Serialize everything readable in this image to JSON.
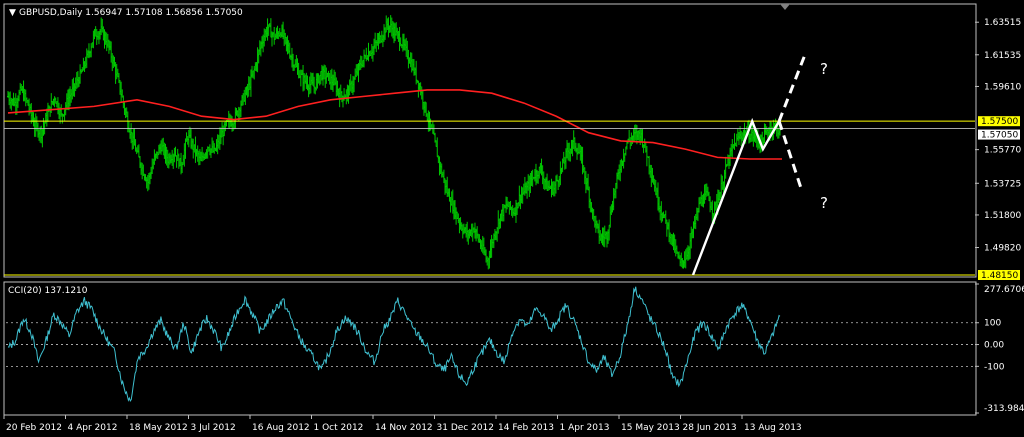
{
  "header": {
    "menu_arrow": "▼",
    "title": "GBPUSD,Daily  1.56947 1.57108 1.56856 1.57050"
  },
  "cci": {
    "label": "CCI(20) 137.1210"
  },
  "annotations": {
    "question_up": "?",
    "question_down": "?"
  },
  "colors": {
    "background": "#000000",
    "bars": "#00c800",
    "ma": "#ff2020",
    "support_resistance": "#ffff00",
    "cci_line": "#3fbfcf",
    "grid": "#c0c0c0",
    "price_tag_bg": "#ffff00",
    "current_tag_bg": "#ffffff",
    "axis_text": "#ffffff",
    "overlay": "#ffffff"
  },
  "chart_data": [
    {
      "type": "ohlc",
      "symbol": "GBPUSD",
      "timeframe": "Daily",
      "ohlc_current": {
        "open": 1.56947,
        "high": 1.57108,
        "low": 1.56856,
        "close": 1.5705
      },
      "ylim": [
        1.4815,
        1.645
      ],
      "y_ticks": [
        1.63515,
        1.61535,
        1.5961,
        1.5577,
        1.53725,
        1.518,
        1.4982
      ],
      "y_tick_labels": [
        "1.63515",
        "1.61535",
        "1.59610",
        "1.55770",
        "1.53725",
        "1.51800",
        "1.49820"
      ],
      "x_tick_labels": [
        "20 Feb 2012",
        "4 Apr 2012",
        "18 May 2012",
        "3 Jul 2012",
        "16 Aug 2012",
        "1 Oct 2012",
        "14 Nov 2012",
        "31 Dec 2012",
        "14 Feb 2013",
        "1 Apr 2013",
        "15 May 2013",
        "28 Jun 2013",
        "13 Aug 2013"
      ],
      "horizontal_levels": [
        {
          "value": 1.575,
          "label": "1.57500"
        },
        {
          "value": 1.4815,
          "label": "1.48150"
        }
      ],
      "current_price": {
        "value": 1.5705,
        "label": "1.57050"
      },
      "series": [
        {
          "kind": "close_path",
          "values": [
            [
              0,
              1.59
            ],
            [
              6,
              1.586
            ],
            [
              12,
              1.594
            ],
            [
              18,
              1.585
            ],
            [
              24,
              1.572
            ],
            [
              30,
              1.568
            ],
            [
              36,
              1.58
            ],
            [
              42,
              1.59
            ],
            [
              48,
              1.578
            ],
            [
              54,
              1.588
            ],
            [
              60,
              1.596
            ],
            [
              66,
              1.604
            ],
            [
              72,
              1.615
            ],
            [
              78,
              1.628
            ],
            [
              84,
              1.63
            ],
            [
              90,
              1.622
            ],
            [
              96,
              1.608
            ],
            [
              102,
              1.592
            ],
            [
              108,
              1.574
            ],
            [
              114,
              1.56
            ],
            [
              120,
              1.548
            ],
            [
              126,
              1.538
            ],
            [
              132,
              1.552
            ],
            [
              138,
              1.56
            ],
            [
              144,
              1.552
            ],
            [
              150,
              1.556
            ],
            [
              156,
              1.548
            ],
            [
              162,
              1.566
            ],
            [
              168,
              1.558
            ],
            [
              174,
              1.55
            ],
            [
              180,
              1.56
            ],
            [
              186,
              1.556
            ],
            [
              192,
              1.566
            ],
            [
              198,
              1.574
            ],
            [
              204,
              1.576
            ],
            [
              210,
              1.586
            ],
            [
              216,
              1.594
            ],
            [
              222,
              1.606
            ],
            [
              228,
              1.622
            ],
            [
              234,
              1.632
            ],
            [
              240,
              1.626
            ],
            [
              246,
              1.63
            ],
            [
              252,
              1.62
            ],
            [
              258,
              1.61
            ],
            [
              264,
              1.602
            ],
            [
              270,
              1.598
            ],
            [
              276,
              1.596
            ],
            [
              282,
              1.604
            ],
            [
              288,
              1.602
            ],
            [
              294,
              1.598
            ],
            [
              300,
              1.59
            ],
            [
              306,
              1.592
            ],
            [
              312,
              1.6
            ],
            [
              318,
              1.61
            ],
            [
              324,
              1.616
            ],
            [
              330,
              1.62
            ],
            [
              336,
              1.626
            ],
            [
              342,
              1.634
            ],
            [
              348,
              1.63
            ],
            [
              354,
              1.624
            ],
            [
              360,
              1.616
            ],
            [
              366,
              1.606
            ],
            [
              372,
              1.594
            ],
            [
              378,
              1.578
            ],
            [
              384,
              1.564
            ],
            [
              390,
              1.546
            ],
            [
              396,
              1.532
            ],
            [
              402,
              1.522
            ],
            [
              408,
              1.512
            ],
            [
              414,
              1.506
            ],
            [
              420,
              1.51
            ],
            [
              426,
              1.5
            ],
            [
              432,
              1.49
            ],
            [
              438,
              1.505
            ],
            [
              444,
              1.518
            ],
            [
              450,
              1.524
            ],
            [
              456,
              1.52
            ],
            [
              462,
              1.53
            ],
            [
              468,
              1.534
            ],
            [
              474,
              1.542
            ],
            [
              480,
              1.546
            ],
            [
              486,
              1.535
            ],
            [
              492,
              1.534
            ],
            [
              498,
              1.544
            ],
            [
              504,
              1.556
            ],
            [
              510,
              1.562
            ],
            [
              516,
              1.554
            ],
            [
              522,
              1.536
            ],
            [
              528,
              1.516
            ],
            [
              534,
              1.504
            ],
            [
              540,
              1.506
            ],
            [
              546,
              1.53
            ],
            [
              552,
              1.548
            ],
            [
              558,
              1.562
            ],
            [
              564,
              1.566
            ],
            [
              570,
              1.568
            ],
            [
              576,
              1.555
            ],
            [
              582,
              1.538
            ],
            [
              588,
              1.522
            ],
            [
              594,
              1.512
            ],
            [
              600,
              1.5
            ],
            [
              606,
              1.488
            ],
            [
              612,
              1.494
            ],
            [
              618,
              1.51
            ],
            [
              624,
              1.526
            ],
            [
              630,
              1.53
            ],
            [
              636,
              1.52
            ],
            [
              642,
              1.532
            ],
            [
              648,
              1.548
            ],
            [
              654,
              1.56
            ],
            [
              660,
              1.566
            ],
            [
              666,
              1.568
            ],
            [
              672,
              1.566
            ],
            [
              678,
              1.562
            ],
            [
              684,
              1.568
            ],
            [
              690,
              1.572
            ],
            [
              696,
              1.569
            ]
          ]
        },
        {
          "kind": "moving_average",
          "values": [
            [
              0,
              1.58
            ],
            [
              40,
              1.582
            ],
            [
              80,
              1.584
            ],
            [
              120,
              1.588
            ],
            [
              150,
              1.584
            ],
            [
              180,
              1.578
            ],
            [
              210,
              1.576
            ],
            [
              240,
              1.578
            ],
            [
              270,
              1.584
            ],
            [
              300,
              1.588
            ],
            [
              330,
              1.59
            ],
            [
              360,
              1.592
            ],
            [
              390,
              1.594
            ],
            [
              420,
              1.594
            ],
            [
              450,
              1.592
            ],
            [
              480,
              1.586
            ],
            [
              510,
              1.578
            ],
            [
              540,
              1.568
            ],
            [
              570,
              1.563
            ],
            [
              600,
              1.562
            ],
            [
              630,
              1.558
            ],
            [
              660,
              1.553
            ],
            [
              690,
              1.552
            ],
            [
              720,
              1.552
            ]
          ]
        },
        {
          "kind": "overlay_solid",
          "values": [
            [
              0,
              1.4815
            ],
            [
              55,
              1.575
            ],
            [
              65,
              1.558
            ],
            [
              80,
              1.575
            ]
          ]
        },
        {
          "kind": "overlay_dashed_up",
          "values": [
            [
              80,
              1.575
            ],
            [
              105,
              1.617
            ]
          ]
        },
        {
          "kind": "overlay_dashed_down",
          "values": [
            [
              80,
              1.575
            ],
            [
              100,
              1.535
            ]
          ]
        }
      ]
    },
    {
      "type": "line",
      "name": "CCI(20) 137.1210",
      "ylim": [
        -313.9841,
        277.6706
      ],
      "y_ticks": [
        277.6706,
        100,
        0,
        -100,
        -313.9841
      ],
      "y_tick_labels": [
        "277.6706",
        "100",
        "0.00",
        "-100",
        "-313.9841"
      ],
      "levels": [
        100,
        0,
        -100
      ],
      "values": [
        [
          0,
          -20
        ],
        [
          8,
          20
        ],
        [
          16,
          120
        ],
        [
          24,
          60
        ],
        [
          32,
          -80
        ],
        [
          40,
          20
        ],
        [
          48,
          140
        ],
        [
          56,
          100
        ],
        [
          64,
          40
        ],
        [
          72,
          150
        ],
        [
          80,
          200
        ],
        [
          88,
          160
        ],
        [
          96,
          80
        ],
        [
          104,
          20
        ],
        [
          112,
          -40
        ],
        [
          120,
          -180
        ],
        [
          128,
          -260
        ],
        [
          136,
          -60
        ],
        [
          144,
          -20
        ],
        [
          152,
          60
        ],
        [
          160,
          110
        ],
        [
          168,
          30
        ],
        [
          176,
          -20
        ],
        [
          184,
          100
        ],
        [
          192,
          -40
        ],
        [
          200,
          60
        ],
        [
          208,
          120
        ],
        [
          216,
          60
        ],
        [
          224,
          -20
        ],
        [
          232,
          60
        ],
        [
          240,
          150
        ],
        [
          248,
          210
        ],
        [
          256,
          140
        ],
        [
          264,
          60
        ],
        [
          272,
          110
        ],
        [
          280,
          170
        ],
        [
          288,
          200
        ],
        [
          296,
          120
        ],
        [
          304,
          40
        ],
        [
          312,
          -20
        ],
        [
          320,
          -60
        ],
        [
          328,
          -120
        ],
        [
          336,
          -40
        ],
        [
          344,
          60
        ],
        [
          352,
          120
        ],
        [
          360,
          100
        ],
        [
          368,
          40
        ],
        [
          376,
          -40
        ],
        [
          384,
          -80
        ],
        [
          392,
          60
        ],
        [
          400,
          120
        ],
        [
          408,
          200
        ],
        [
          416,
          140
        ],
        [
          424,
          70
        ],
        [
          432,
          30
        ],
        [
          440,
          -20
        ],
        [
          448,
          -90
        ],
        [
          456,
          -120
        ],
        [
          464,
          -60
        ],
        [
          472,
          -140
        ],
        [
          480,
          -180
        ],
        [
          488,
          -100
        ],
        [
          496,
          -40
        ],
        [
          504,
          20
        ],
        [
          512,
          -40
        ],
        [
          520,
          -80
        ],
        [
          528,
          60
        ],
        [
          536,
          120
        ],
        [
          544,
          80
        ],
        [
          552,
          160
        ],
        [
          560,
          140
        ],
        [
          568,
          60
        ],
        [
          576,
          120
        ],
        [
          584,
          180
        ],
        [
          592,
          110
        ],
        [
          600,
          20
        ],
        [
          608,
          -80
        ],
        [
          616,
          -120
        ],
        [
          624,
          -60
        ],
        [
          632,
          -140
        ],
        [
          640,
          -60
        ],
        [
          648,
          80
        ],
        [
          656,
          260
        ],
        [
          664,
          200
        ],
        [
          672,
          120
        ],
        [
          680,
          60
        ],
        [
          688,
          -20
        ],
        [
          696,
          -160
        ],
        [
          704,
          -180
        ],
        [
          712,
          -60
        ],
        [
          720,
          60
        ],
        [
          728,
          100
        ],
        [
          736,
          40
        ],
        [
          744,
          -20
        ],
        [
          752,
          80
        ],
        [
          760,
          140
        ],
        [
          768,
          180
        ],
        [
          776,
          120
        ],
        [
          784,
          20
        ],
        [
          792,
          -40
        ],
        [
          800,
          40
        ],
        [
          808,
          137
        ]
      ]
    }
  ]
}
